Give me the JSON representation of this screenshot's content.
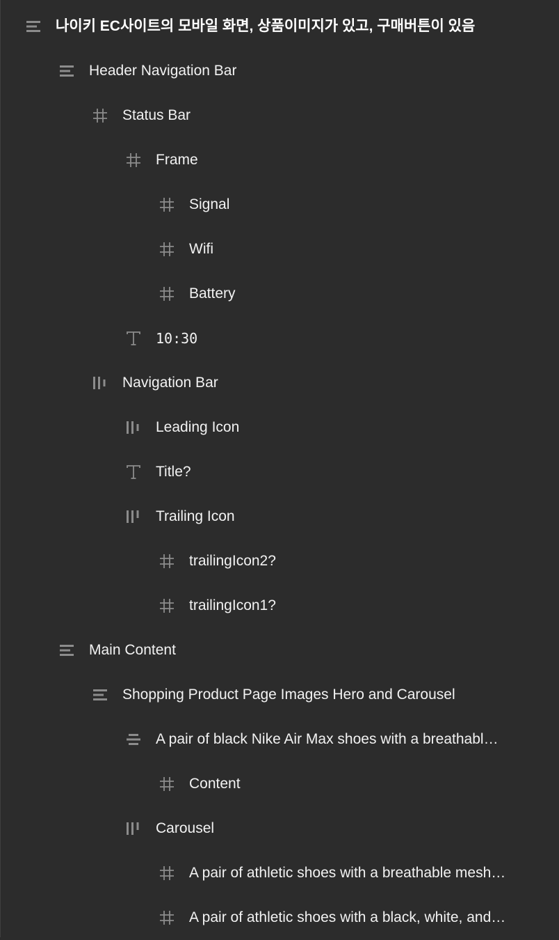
{
  "colors": {
    "panel_background": "#2c2c2c",
    "icon_color": "#8c8c8c",
    "text_color": "#f2f2f2"
  },
  "layers": [
    {
      "label": "나이키 EC사이트의 모바일 화면, 상품이미지가 있고, 구매버튼이 있음",
      "icon": "vertical-stack-icon",
      "depth": 0,
      "bold": true
    },
    {
      "label": "Header Navigation Bar",
      "icon": "vertical-stack-icon",
      "depth": 1
    },
    {
      "label": "Status Bar",
      "icon": "frame-icon",
      "depth": 2
    },
    {
      "label": "Frame",
      "icon": "frame-icon",
      "depth": 3
    },
    {
      "label": "Signal",
      "icon": "frame-icon",
      "depth": 4
    },
    {
      "label": "Wifi",
      "icon": "frame-icon",
      "depth": 4
    },
    {
      "label": "Battery",
      "icon": "frame-icon",
      "depth": 4
    },
    {
      "label": "10:30",
      "icon": "text-icon",
      "depth": 3,
      "mono": true
    },
    {
      "label": "Navigation Bar",
      "icon": "horizontal-stack-center-icon",
      "depth": 2
    },
    {
      "label": "Leading Icon",
      "icon": "horizontal-stack-center-icon",
      "depth": 3
    },
    {
      "label": "Title?",
      "icon": "text-icon",
      "depth": 3
    },
    {
      "label": "Trailing Icon",
      "icon": "horizontal-stack-top-icon",
      "depth": 3
    },
    {
      "label": "trailingIcon2?",
      "icon": "frame-icon",
      "depth": 4
    },
    {
      "label": "trailingIcon1?",
      "icon": "frame-icon",
      "depth": 4
    },
    {
      "label": "Main Content",
      "icon": "vertical-stack-icon",
      "depth": 1
    },
    {
      "label": "Shopping Product Page Images Hero and Carousel",
      "icon": "vertical-stack-icon",
      "depth": 2
    },
    {
      "label": "A pair of black Nike Air Max shoes with a breathabl…",
      "icon": "vertical-stack-center-icon",
      "depth": 3
    },
    {
      "label": "Content",
      "icon": "frame-icon",
      "depth": 4
    },
    {
      "label": "Carousel",
      "icon": "horizontal-stack-top-icon",
      "depth": 3
    },
    {
      "label": "A pair of athletic shoes with a breathable mesh…",
      "icon": "frame-icon",
      "depth": 4
    },
    {
      "label": "A pair of athletic shoes with a black, white, and…",
      "icon": "frame-icon",
      "depth": 4
    }
  ]
}
